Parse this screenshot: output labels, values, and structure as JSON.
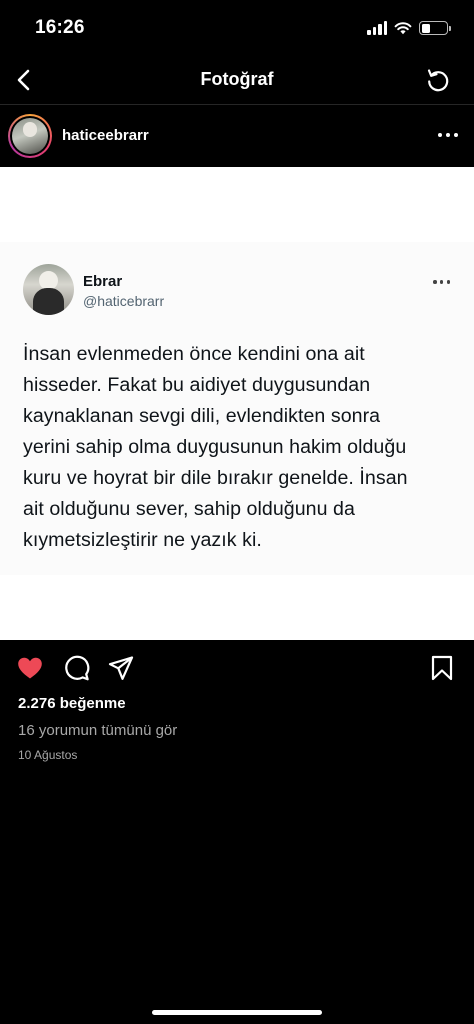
{
  "status_bar": {
    "time": "16:26",
    "signal_icon": "cellular-signal-icon",
    "wifi_icon": "wifi-icon",
    "battery_icon": "battery-icon",
    "battery_level": 0.35
  },
  "nav": {
    "back_icon": "chevron-left-icon",
    "title": "Fotoğraf",
    "refresh_icon": "refresh-icon"
  },
  "post": {
    "username": "haticeebrarr",
    "more_icon": "more-horizontal-icon"
  },
  "tweet": {
    "display_name": "Ebrar",
    "handle": "@haticebrarr",
    "text": "İnsan evlenmeden önce kendini ona ait\nhisseder. Fakat bu aidiyet duygusundan\nkaynaklanan sevgi dili, evlendikten sonra\nyerini sahip olma duygusunun hakim olduğu\nkuru ve hoyrat bir dile bırakır genelde. İnsan\nait olduğunu sever, sahip olduğunu da\nkıymetsizleştirir ne yazık ki."
  },
  "actions": {
    "like_icon": "heart-filled-icon",
    "comment_icon": "comment-icon",
    "share_icon": "send-icon",
    "save_icon": "bookmark-icon",
    "like_color": "#ed4956"
  },
  "stats": {
    "likes": "2.276 beğenme",
    "comments_link": "16 yorumun tümünü gör",
    "date": "10 Ağustos"
  }
}
